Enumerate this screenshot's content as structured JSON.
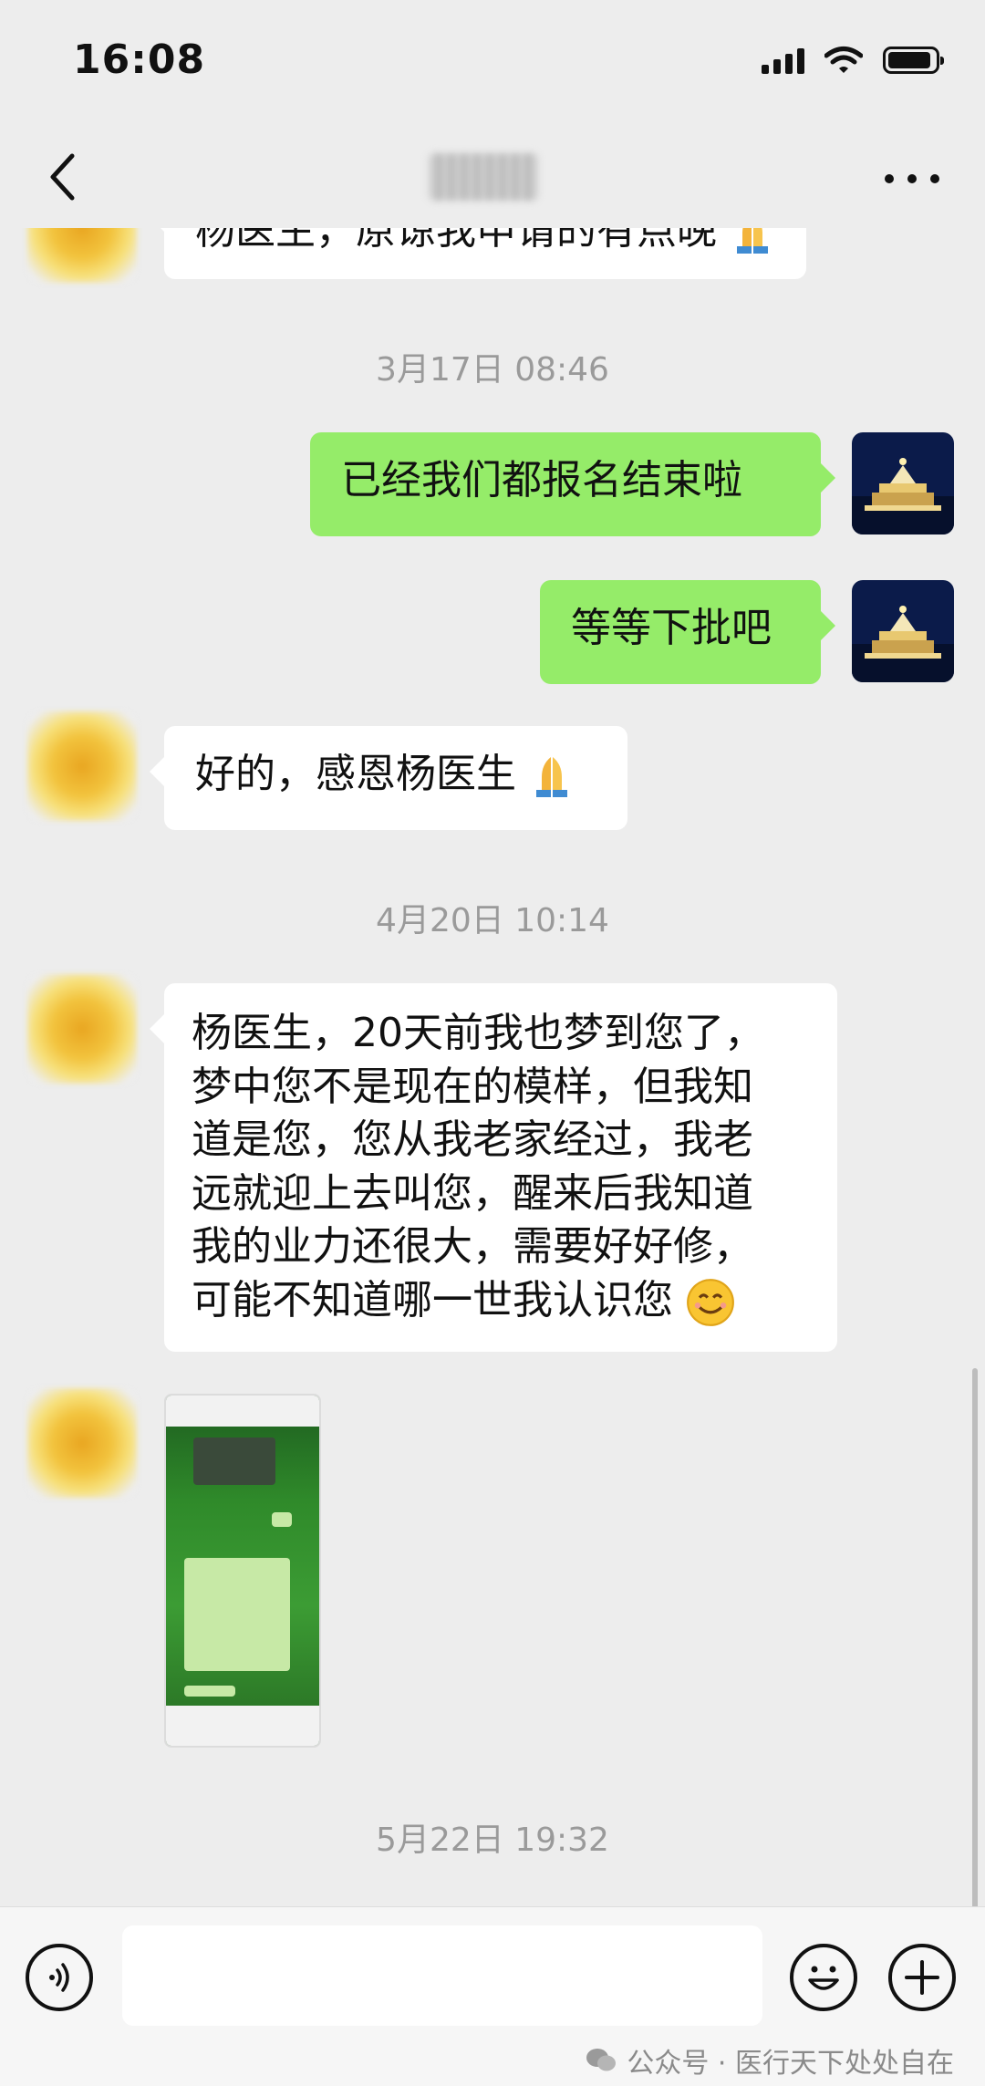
{
  "status_bar": {
    "time": "16:08"
  },
  "header": {
    "back_icon": "chevron-left-icon",
    "more_icon": "more-dots-icon"
  },
  "messages": {
    "m0_partial": "杨医生，原谅我申请的有点晚",
    "ts1": "3月17日 08:46",
    "m1": "已经我们都报名结束啦",
    "m2": "等等下批吧",
    "m3": "好的，感恩杨医生",
    "ts2": "4月20日 10:14",
    "m4_lines": [
      "杨医生，20天前我也梦到您了，",
      "梦中您不是现在的模样，但我知",
      "道是您，您从我老家经过，我老",
      "远就迎上去叫您，醒来后我知道",
      "我的业力还很大，需要好好修，",
      "可能不知道哪一世我认识您"
    ],
    "ts3": "5月22日 19:32"
  },
  "input_bar": {
    "voice_icon": "voice-icon",
    "emoji_icon": "smile-icon",
    "plus_icon": "plus-icon"
  },
  "watermark": {
    "text": "公众号 · 医行天下处处自在"
  }
}
